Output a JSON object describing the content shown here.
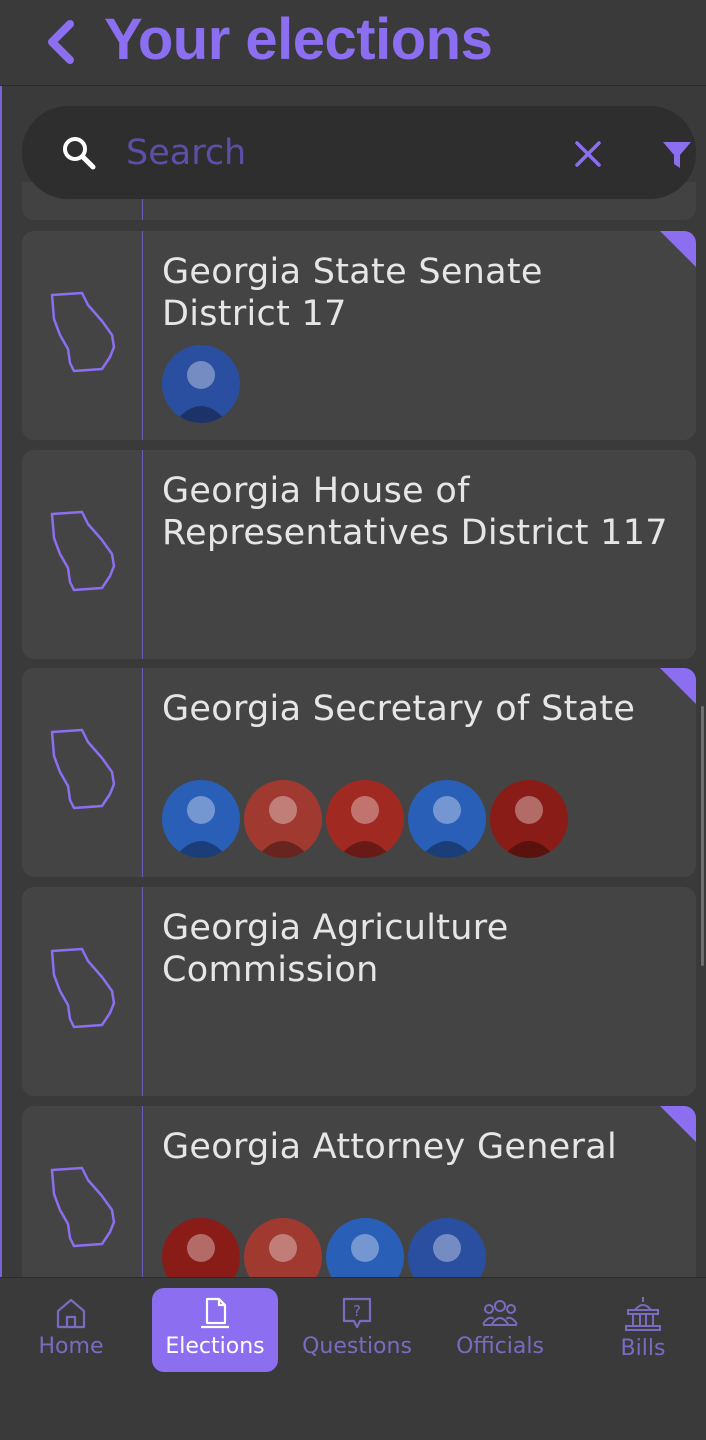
{
  "header": {
    "title": "Your elections",
    "back_icon": "chevron-left-icon"
  },
  "search": {
    "placeholder": "Search",
    "value": "",
    "clear_icon": "close-icon",
    "filter_icon": "filter-icon"
  },
  "elections": [
    {
      "name": "Georgia State Senate District 17",
      "flagged": true,
      "candidates": [
        {
          "party_color": "#2a4fa0"
        }
      ]
    },
    {
      "name": "Georgia House of Representatives District 117",
      "flagged": false,
      "candidates": []
    },
    {
      "name": "Georgia Secretary of State",
      "flagged": true,
      "candidates": [
        {
          "party_color": "#2a5fb8"
        },
        {
          "party_color": "#a03a30"
        },
        {
          "party_color": "#a02a22"
        },
        {
          "party_color": "#2a5fb8"
        },
        {
          "party_color": "#8a1c18"
        }
      ]
    },
    {
      "name": "Georgia Agriculture Commission",
      "flagged": false,
      "candidates": []
    },
    {
      "name": "Georgia Attorney General",
      "flagged": true,
      "candidates": [
        {
          "party_color": "#8a1c18"
        },
        {
          "party_color": "#a03a30"
        },
        {
          "party_color": "#2a5fb8"
        },
        {
          "party_color": "#2a4fa0"
        }
      ]
    }
  ],
  "nav": {
    "items": [
      {
        "label": "Home",
        "icon": "home-icon",
        "active": false
      },
      {
        "label": "Elections",
        "icon": "ballot-icon",
        "active": true
      },
      {
        "label": "Questions",
        "icon": "question-icon",
        "active": false
      },
      {
        "label": "Officials",
        "icon": "people-icon",
        "active": false
      },
      {
        "label": "Bills",
        "icon": "capitol-icon",
        "active": false
      }
    ]
  },
  "colors": {
    "accent": "#8b6ff0",
    "background": "#3a3a3a",
    "card": "#444444"
  }
}
